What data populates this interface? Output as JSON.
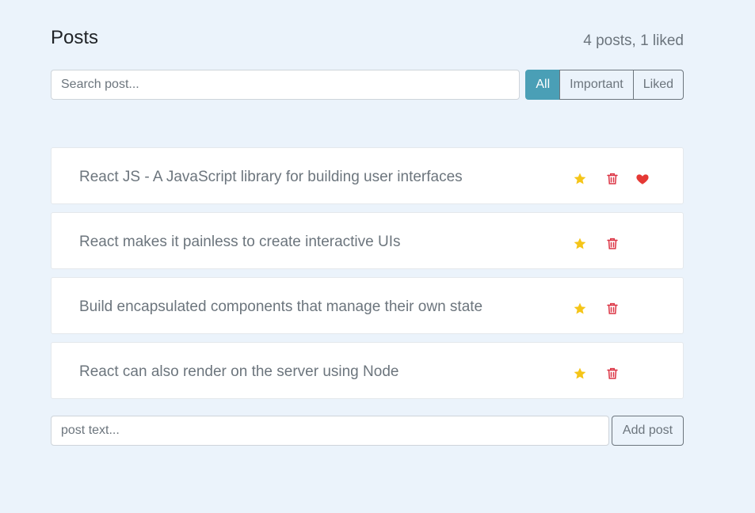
{
  "header": {
    "title": "Posts",
    "counter": "4 posts, 1 liked"
  },
  "search": {
    "placeholder": "Search post...",
    "value": ""
  },
  "filters": [
    {
      "label": "All",
      "active": true
    },
    {
      "label": "Important",
      "active": false
    },
    {
      "label": "Liked",
      "active": false
    }
  ],
  "posts": [
    {
      "label": "React JS - A JavaScript library for building user interfaces",
      "important": true,
      "liked": true
    },
    {
      "label": "React makes it painless to create interactive UIs",
      "important": true,
      "liked": false
    },
    {
      "label": "Build encapsulated components that manage their own state",
      "important": true,
      "liked": false
    },
    {
      "label": "React can also render on the server using Node",
      "important": true,
      "liked": false
    }
  ],
  "add_form": {
    "placeholder": "post text...",
    "value": "",
    "button_label": "Add post"
  },
  "icons": {
    "star": "star-icon",
    "trash": "trash-icon",
    "heart": "heart-icon"
  },
  "colors": {
    "background": "#ebf3fb",
    "accent": "#4a9fb6",
    "star": "#f5c518",
    "trash": "#dc3545",
    "heart": "#e53935",
    "muted": "#6c757d"
  }
}
